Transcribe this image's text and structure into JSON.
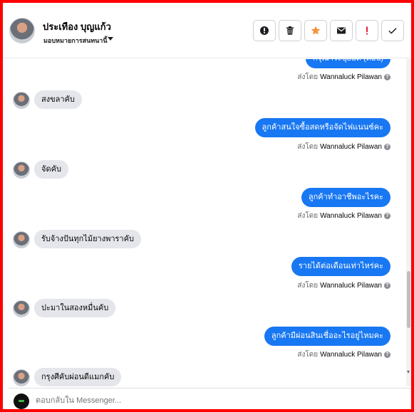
{
  "header": {
    "contact_name": "ประเทือง บุญแก้ว",
    "assign_label": "มอบหมายการสนทนานี้",
    "toolbar": [
      {
        "icon": "alert-icon",
        "name": "mark-spam-button"
      },
      {
        "icon": "trash-icon",
        "name": "delete-button"
      },
      {
        "icon": "star-icon",
        "name": "follow-up-button",
        "color": "#f7923b"
      },
      {
        "icon": "mail-icon",
        "name": "mark-unread-button"
      },
      {
        "icon": "exclamation-icon",
        "name": "priority-button",
        "color": "#e41e3f"
      },
      {
        "icon": "check-icon",
        "name": "mark-done-button"
      }
    ]
  },
  "messages": [
    {
      "direction": "out",
      "text": "กรุณาระบุยอด (ต่อปี)"
    },
    {
      "direction": "sent_by",
      "prefix": "ส่งโดย",
      "who": "Wannaluck Pilawan"
    },
    {
      "direction": "in",
      "text": "สงขลาคับ"
    },
    {
      "direction": "out",
      "text": "ลูกค้าสนใจซื้อสดหรือจัดไฟแนนซ์คะ"
    },
    {
      "direction": "sent_by",
      "prefix": "ส่งโดย",
      "who": "Wannaluck Pilawan"
    },
    {
      "direction": "in",
      "text": "จัดคับ"
    },
    {
      "direction": "out",
      "text": "ลูกค้าทำอาชีพอะไรคะ"
    },
    {
      "direction": "sent_by",
      "prefix": "ส่งโดย",
      "who": "Wannaluck Pilawan"
    },
    {
      "direction": "in",
      "text": "รับจ้างปันทุกไม้ยางพาราคับ"
    },
    {
      "direction": "out",
      "text": "รายได้ต่อเดือนเท่าไหร่คะ"
    },
    {
      "direction": "sent_by",
      "prefix": "ส่งโดย",
      "who": "Wannaluck Pilawan"
    },
    {
      "direction": "in",
      "text": "ปะมาในสองหมื่นคับ"
    },
    {
      "direction": "out",
      "text": "ลูกค้ามีผ่อนสินเชื่ออะไรอยู่ไหมคะ"
    },
    {
      "direction": "sent_by",
      "prefix": "ส่งโดย",
      "who": "Wannaluck Pilawan"
    },
    {
      "direction": "in",
      "text": "กรุงศีคับผ่อนดีแมกคับ"
    }
  ],
  "composer": {
    "placeholder": "ตอบกลับใน Messenger..."
  },
  "colors": {
    "frame": "#ff0000",
    "outgoing_bubble": "#1877f2",
    "incoming_bubble": "#e4e6eb"
  }
}
